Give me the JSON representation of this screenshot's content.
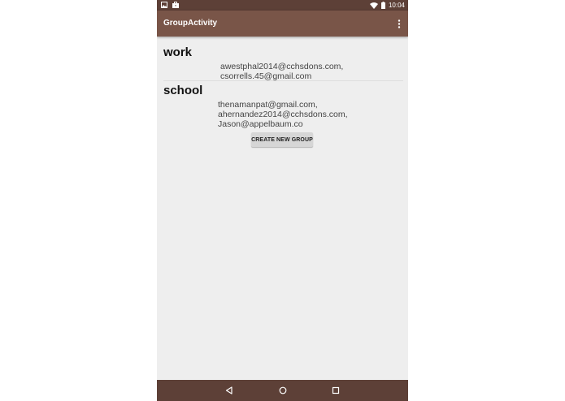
{
  "status_bar": {
    "time": "10:04",
    "icons": [
      "image-icon",
      "briefcase-icon",
      "wifi-icon",
      "battery-icon"
    ]
  },
  "app_bar": {
    "title": "GroupActivity",
    "overflow_icon": "more-vert-icon"
  },
  "groups": [
    {
      "name": "work",
      "emails": [
        "awestphal2014@cchsdons.com,",
        "csorrells.45@gmail.com"
      ]
    },
    {
      "name": "school",
      "emails": [
        "thenamanpat@gmail.com,",
        "ahernandez2014@cchsdons.com,",
        "Jason@appelbaum.co"
      ]
    }
  ],
  "create_button": {
    "label": "CREATE NEW GROUP"
  },
  "nav_bar": {
    "icons": [
      "back-icon",
      "home-icon",
      "recents-icon"
    ]
  },
  "colors": {
    "status_bar": "#5d4037",
    "app_bar": "#795548",
    "background": "#eeeeee",
    "button": "#d6d6d6"
  }
}
